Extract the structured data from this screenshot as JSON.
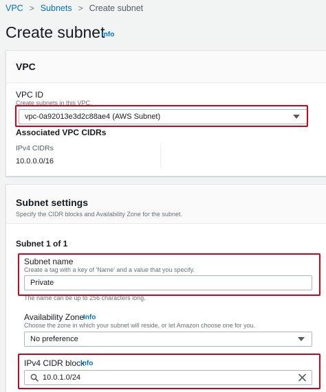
{
  "breadcrumb": {
    "items": [
      "VPC",
      "Subnets",
      "Create subnet"
    ],
    "separator": ">"
  },
  "page": {
    "title": "Create subnet",
    "info": "Info"
  },
  "vpc_panel": {
    "heading": "VPC",
    "vpc_id_label": "VPC ID",
    "vpc_id_desc": "Create subnets in this VPC.",
    "vpc_id_value": "vpc-0a92013e3d2c88ae4 (AWS Subnet)",
    "associated_heading": "Associated VPC CIDRs",
    "ipv4_label": "IPv4 CIDRs",
    "ipv4_value": "10.0.0.0/16"
  },
  "subnet_panel": {
    "heading": "Subnet settings",
    "desc": "Specify the CIDR blocks and Availability Zone for the subnet.",
    "subnet_count": "Subnet 1 of 1",
    "name_label": "Subnet name",
    "name_desc": "Create a tag with a key of 'Name' and a value that you specify.",
    "name_value": "Private",
    "name_constraint": "The name can be up to 256 characters long.",
    "az_label": "Availability Zone",
    "az_info": "Info",
    "az_desc": "Choose the zone in which your subnet will reside, or let Amazon choose one for you.",
    "az_value": "No preference",
    "cidr_label": "IPv4 CIDR block",
    "cidr_info": "Info",
    "cidr_value": "10.0.1.0/24"
  },
  "colors": {
    "link": "#0073bb",
    "highlight": "#d0021b",
    "background": "#f2f3f3"
  },
  "icons": [
    "chevron-right-icon",
    "caret-down-icon",
    "search-icon",
    "close-icon"
  ]
}
